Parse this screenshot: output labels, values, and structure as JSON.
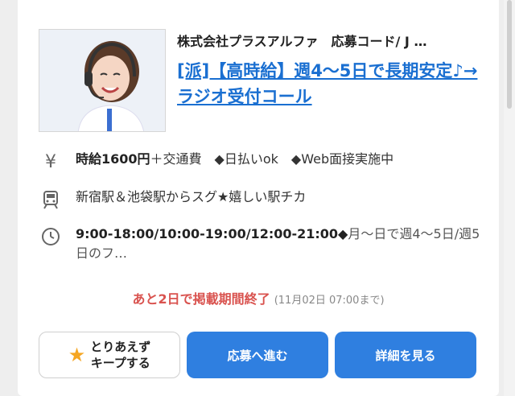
{
  "job": {
    "company": "株式会社プラスアルファ　応募コード/ J …",
    "title": "[派]【高時給】週4〜5日で長期安定♪→ラジオ受付コール",
    "photo_alt": "operator-with-headset"
  },
  "details": {
    "salary_strong": "時給1600円",
    "salary_rest": "＋交通費　◆日払いok　◆Web面接実施中",
    "station": "新宿駅＆池袋駅からスグ★嬉しい駅チカ",
    "hours_main": "9:00-18:00/10:00-19:00/12:00-21:00◆",
    "hours_rest": "月〜日で週4〜5日/週5日のフ…",
    "icons": [
      "yen-icon",
      "train-icon",
      "clock-icon"
    ]
  },
  "deadline": {
    "warning": "あと2日で掲載期間終了",
    "date": "(11月02日 07:00まで)"
  },
  "buttons": {
    "keep": "とりあえず\nキープする",
    "apply": "応募へ進む",
    "detail": "詳細を見る"
  },
  "colors": {
    "link": "#1a6fd1",
    "primary_button": "#2f7fe0",
    "warning": "#d9534f",
    "star": "#f5a623"
  }
}
